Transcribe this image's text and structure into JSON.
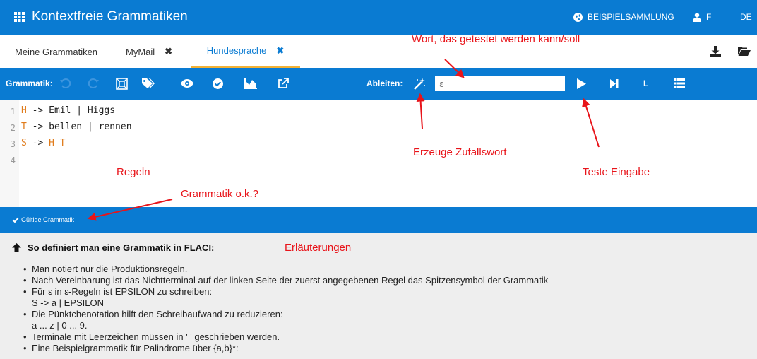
{
  "appbar": {
    "title": "Kontextfreie Grammatiken",
    "samples_label": "BEISPIELSAMMLUNG",
    "user_label": "F",
    "language": "DE"
  },
  "tabs": [
    {
      "label": "Meine Grammatiken",
      "closable": false,
      "active": false
    },
    {
      "label": "MyMail",
      "closable": true,
      "active": false
    },
    {
      "label": "Hundesprache",
      "closable": true,
      "active": true
    }
  ],
  "toolbar": {
    "grammar_label": "Grammatik:",
    "derive_label": "Ableiten:",
    "derive_input_placeholder": "ε",
    "l_label": "L"
  },
  "editor": {
    "lines": [
      {
        "no": "1",
        "lhs": "H",
        "rhs": " -> Emil | Higgs"
      },
      {
        "no": "2",
        "lhs": "T",
        "rhs": " -> bellen | rennen"
      },
      {
        "no": "3",
        "lhs": "S",
        "rhs": " -> ",
        "rhs_nt": "H T"
      },
      {
        "no": "4",
        "lhs": "",
        "rhs": ""
      }
    ]
  },
  "status": {
    "text": "Gültige Grammatik"
  },
  "explanation": {
    "heading": "So definiert man eine Grammatik in FLACI:",
    "items": [
      "Man notiert nur die Produktionsregeln.",
      "Nach Vereinbarung ist das Nichtterminal auf der linken Seite der zuerst angegebenen Regel das Spitzensymbol der Grammatik",
      "Für ε in ε-Regeln ist EPSILON zu schreiben:",
      "S -> a | EPSILON",
      "Die Pünktchenotation hilft den Schreibaufwand zu reduzieren:",
      "a ... z | 0 ... 9.",
      "Terminale mit Leerzeichen müssen in ' ' geschrieben werden.",
      "Eine Beispielgrammatik für Palindrome über {a,b}*:"
    ]
  },
  "annotations": {
    "word": "Wort, das getestet werden kann/soll",
    "random_word": "Erzeuge Zufallswort",
    "rules": "Regeln",
    "test_input": "Teste Eingabe",
    "grammar_ok": "Grammatik o.k.?",
    "explanations": "Erläuterungen"
  },
  "colors": {
    "primary": "#0a7bd2",
    "active_tab_underline": "#f2b134",
    "annotation": "#e8141a",
    "nonterminal": "#e07c1c"
  }
}
